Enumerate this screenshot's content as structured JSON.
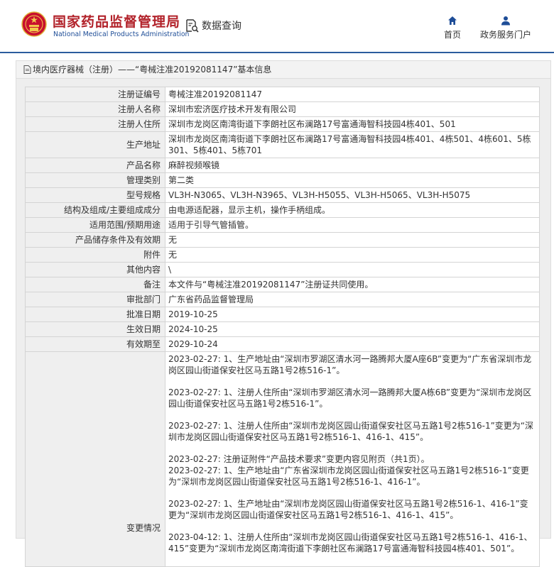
{
  "header": {
    "logo_cn": "国家药品监督管理局",
    "logo_en": "National Medical Products Administration",
    "search_label": "数据查询",
    "home_label": "首页",
    "portal_label": "政务服务门户"
  },
  "breadcrumb": "境内医疗器械（注册）——“粤械注准20192081147”基本信息",
  "rows": [
    {
      "label": "注册证编号",
      "value": "粤械注准20192081147"
    },
    {
      "label": "注册人名称",
      "value": "深圳市宏济医疗技术开发有限公司"
    },
    {
      "label": "注册人住所",
      "value": "深圳市龙岗区南湾街道下李朗社区布澜路17号富通海智科技园4栋401、501"
    },
    {
      "label": "生产地址",
      "value": "深圳市龙岗区南湾街道下李朗社区布澜路17号富通海智科技园4栋401、4栋501、4栋601、5栋301、5栋401、5栋701"
    },
    {
      "label": "产品名称",
      "value": "麻醉视频喉镜"
    },
    {
      "label": "管理类别",
      "value": "第二类"
    },
    {
      "label": "型号规格",
      "value": "VL3H-N3065、VL3H-N3965、VL3H-H5055、VL3H-H5065、VL3H-H5075"
    },
    {
      "label": "结构及组成/主要组成成分",
      "value": "由电源适配器，显示主机，操作手柄组成。"
    },
    {
      "label": "适用范围/预期用途",
      "value": "适用于引导气管插管。"
    },
    {
      "label": "产品储存条件及有效期",
      "value": "无"
    },
    {
      "label": "附件",
      "value": "无"
    },
    {
      "label": "其他内容",
      "value": "\\"
    },
    {
      "label": "备注",
      "value": "本文件与“粤械注准20192081147”注册证共同使用。"
    },
    {
      "label": "审批部门",
      "value": "广东省药品监督管理局"
    },
    {
      "label": "批准日期",
      "value": "2019-10-25"
    },
    {
      "label": "生效日期",
      "value": "2024-10-25"
    },
    {
      "label": "有效期至",
      "value": "2029-10-24"
    }
  ],
  "changes": {
    "label": "变更情况",
    "entries": [
      "2023-02-27: 1、生产地址由“深圳市罗湖区清水河一路腾邦大厦A座6B”变更为“广东省深圳市龙岗区园山街道保安社区马五路1号2栋516-1”。",
      "2023-02-27: 1、注册人住所由“深圳市罗湖区清水河一路腾邦大厦A栋6B”变更为“深圳市龙岗区园山街道保安社区马五路1号2栋516-1”。",
      "2023-02-27: 1、注册人住所由“深圳市龙岗区园山街道保安社区马五路1号2栋516-1”变更为“深圳市龙岗区园山街道保安社区马五路1号2栋516-1、416-1、415”。",
      "2023-02-27: 注册证附件“产品技术要求”变更内容见附页（共1页）。",
      "2023-02-27: 1、生产地址由“广东省深圳市龙岗区园山街道保安社区马五路1号2栋516-1”变更为“深圳市龙岗区园山街道保安社区马五路1号2栋516-1、416-1”。",
      "2023-02-27: 1、生产地址由“深圳市龙岗区园山街道保安社区马五路1号2栋516-1、416-1”变更为“深圳市龙岗区园山街道保安社区马五路1号2栋516-1、416-1、415”。",
      "2023-04-12: 1、注册人住所由“深圳市龙岗区园山街道保安社区马五路1号2栋516-1、416-1、415”变更为“深圳市龙岗区南湾街道下李朗社区布澜路17号富通海智科技园4栋401、501”。"
    ]
  },
  "colors": {
    "brand_red": "#b2222a",
    "brand_blue": "#1e4d97",
    "header_border": "#2b5c9e",
    "label_bg": "#efefef"
  },
  "icons": {
    "logo": "national-emblem-icon",
    "search": "document-search-icon",
    "home": "home-icon",
    "portal": "user-icon",
    "breadcrumb": "document-icon"
  }
}
